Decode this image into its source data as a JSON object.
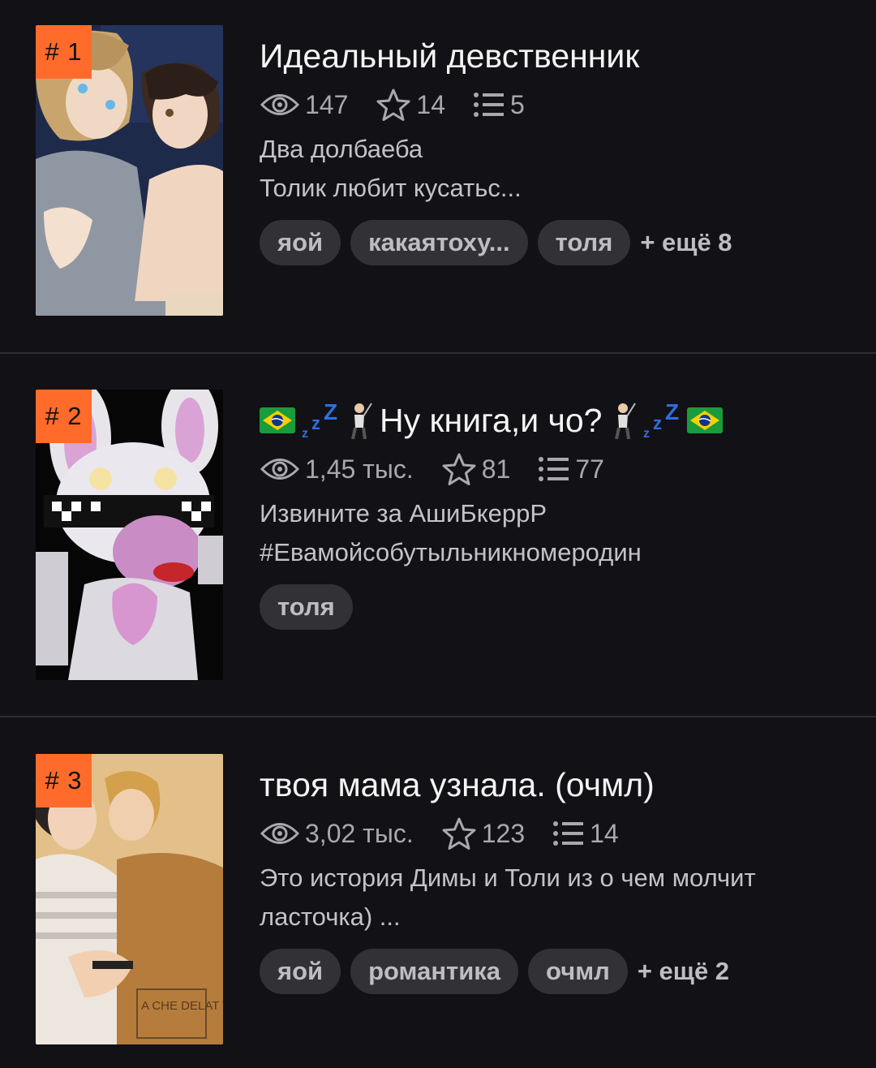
{
  "books": [
    {
      "rank": "# 1",
      "title": "Идеальный девственник",
      "views": "147",
      "stars": "14",
      "chapters": "5",
      "description": [
        "Два долбаеба",
        "Толик любит кусатьс..."
      ],
      "tags": [
        "яой",
        "какаятоху...",
        "толя"
      ],
      "more": "+ ещё 8"
    },
    {
      "rank": "# 2",
      "title_text": "Ну книга,и чо?",
      "views": "1,45 тыс.",
      "stars": "81",
      "chapters": "77",
      "description": [
        "Извините за АшиБкеррР",
        "#Евамойсобутыльникномеродин"
      ],
      "tags": [
        "толя"
      ]
    },
    {
      "rank": "# 3",
      "title": "твоя мама узнала. (очмл)",
      "views": "3,02 тыс.",
      "stars": "123",
      "chapters": "14",
      "description": [
        "Это история Димы и Толи из о чем молчит",
        "ласточка) ..."
      ],
      "tags": [
        "яой",
        "романтика",
        "очмл"
      ],
      "more": "+ ещё 2"
    }
  ],
  "cover3_watermark": "A CHE DELAT TO",
  "colors": {
    "background": "#121115",
    "rank_badge": "#ff6b2b",
    "tag_bg": "#323136",
    "muted_text": "#a9a9ad"
  },
  "icons": [
    "eye-icon",
    "star-icon",
    "list-icon",
    "brazil-flag-icon",
    "zzz-icon",
    "golfer-icon"
  ]
}
